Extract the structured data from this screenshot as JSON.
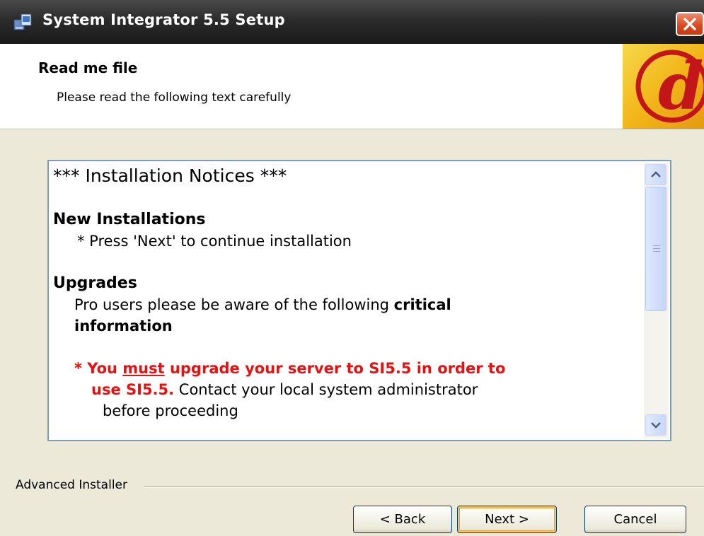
{
  "window": {
    "title": "System Integrator 5.5 Setup"
  },
  "header": {
    "title": "Read me file",
    "subtitle": "Please read the following text carefully",
    "logo_glyph": "d",
    "logo_colors": {
      "bg": "#f2b71a",
      "glyph": "#c2161a"
    }
  },
  "readme": {
    "heading": "*** Installation Notices ***",
    "new_installations": {
      "title": "New Installations",
      "line": "* Press  'Next' to continue installation"
    },
    "upgrades": {
      "title": "Upgrades",
      "line1_pre": "Pro users please be aware of the following ",
      "line1_bold": "critical",
      "line2_bold": "information",
      "red_part1": "* You ",
      "red_part2": "must",
      "red_part3": " upgrade your server to SI5.5 in order to",
      "red_part4": "use SI5.5.",
      "line3_rest": " Contact your local system administrator",
      "line4": "before proceeding"
    }
  },
  "footer": {
    "brand_label": "Advanced Installer",
    "back_label": "< Back",
    "next_label": "Next >",
    "cancel_label": "Cancel"
  },
  "colors": {
    "accent_red": "#e81010",
    "dialog_bg": "#ece9d8",
    "textbox_border": "#7f9db9"
  }
}
